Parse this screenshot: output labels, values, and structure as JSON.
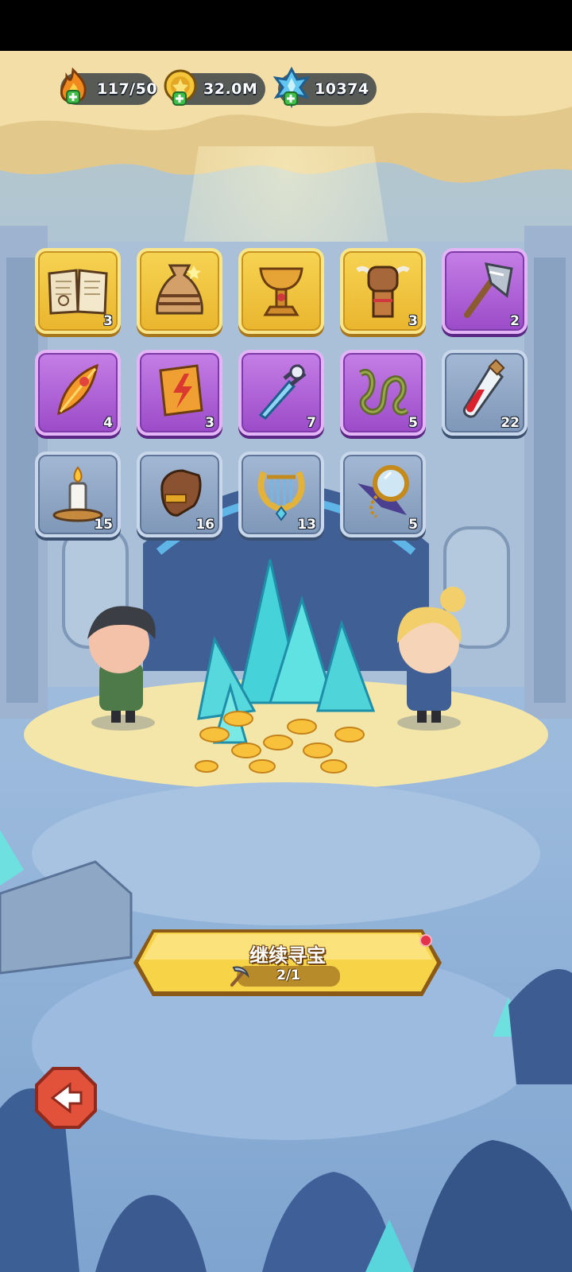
{
  "resources": {
    "energy": {
      "value": "117/50",
      "icon": "flame-icon"
    },
    "gold": {
      "value": "32.0M",
      "icon": "gold-coin-icon"
    },
    "crystal": {
      "value": "10374",
      "icon": "blue-crystal-icon"
    }
  },
  "inventory": [
    {
      "name": "spell-book",
      "count": "3",
      "rarity": "gold"
    },
    {
      "name": "cloth-sack",
      "count": "",
      "rarity": "gold"
    },
    {
      "name": "golden-goblet",
      "count": "",
      "rarity": "gold"
    },
    {
      "name": "bull-totem",
      "count": "3",
      "rarity": "gold"
    },
    {
      "name": "battle-axe",
      "count": "2",
      "rarity": "purple"
    },
    {
      "name": "phoenix-feather",
      "count": "4",
      "rarity": "purple"
    },
    {
      "name": "lightning-tome",
      "count": "3",
      "rarity": "purple"
    },
    {
      "name": "ice-sword",
      "count": "7",
      "rarity": "purple"
    },
    {
      "name": "thorn-vines",
      "count": "5",
      "rarity": "purple"
    },
    {
      "name": "red-potion",
      "count": "22",
      "rarity": "blue"
    },
    {
      "name": "candle",
      "count": "15",
      "rarity": "blue"
    },
    {
      "name": "leather-glove",
      "count": "16",
      "rarity": "blue"
    },
    {
      "name": "golden-lyre",
      "count": "13",
      "rarity": "blue"
    },
    {
      "name": "magic-mirror",
      "count": "5",
      "rarity": "blue"
    }
  ],
  "continue_button": {
    "label": "继续寻宝",
    "progress": "2/1"
  },
  "colors": {
    "gold_slot": "#f0c43e",
    "purple_slot": "#b264d8",
    "blue_slot": "#91a8c6",
    "cave_blue": "#8fb4d8",
    "button_yellow": "#f7d348"
  }
}
